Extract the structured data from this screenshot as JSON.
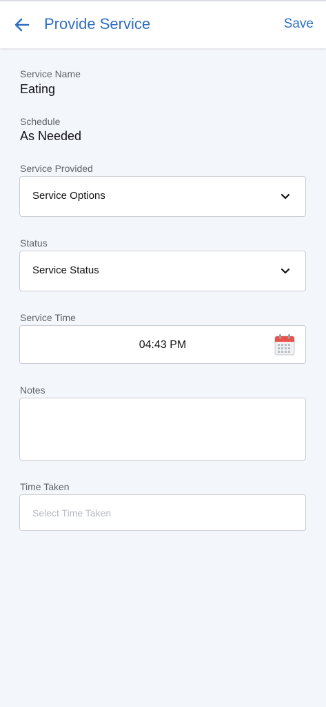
{
  "header": {
    "title": "Provide Service",
    "save_label": "Save"
  },
  "service_name": {
    "label": "Service Name",
    "value": "Eating"
  },
  "schedule": {
    "label": "Schedule",
    "value": "As Needed"
  },
  "service_provided": {
    "label": "Service Provided",
    "selected": "Service Options"
  },
  "status": {
    "label": "Status",
    "selected": "Service Status"
  },
  "service_time": {
    "label": "Service Time",
    "value": "04:43 PM"
  },
  "notes": {
    "label": "Notes",
    "value": ""
  },
  "time_taken": {
    "label": "Time Taken",
    "placeholder": "Select Time Taken"
  },
  "colors": {
    "accent": "#2f6fc1",
    "background": "#f3f6fb",
    "calendar_red": "#e8524a"
  },
  "icons": {
    "back": "arrow-left-icon",
    "dropdown": "chevron-down-icon",
    "calendar": "calendar-icon"
  }
}
